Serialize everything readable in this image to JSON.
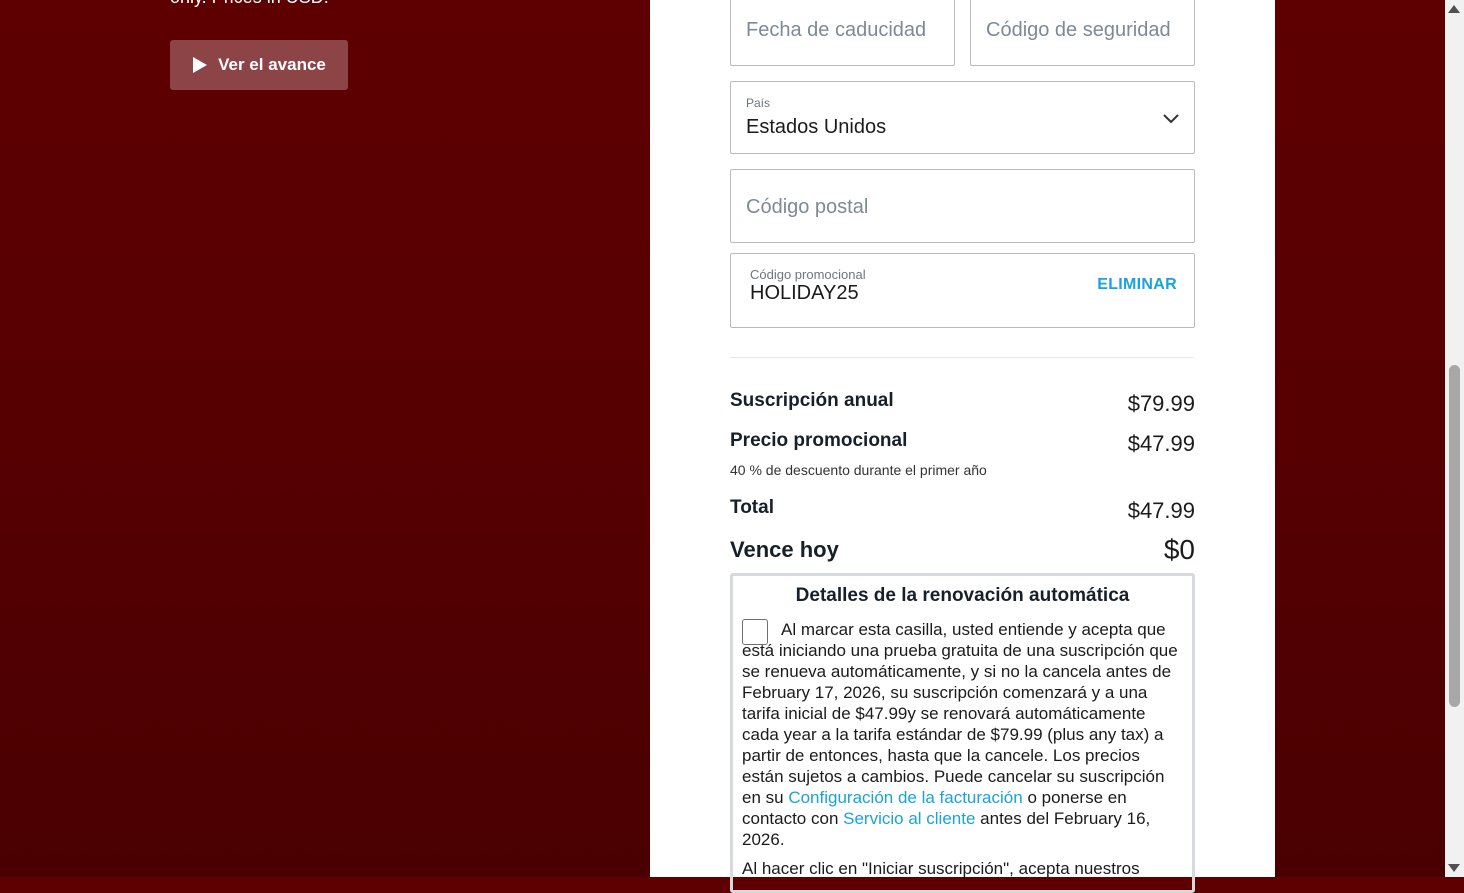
{
  "left": {
    "cut_text": "only. Prices in USD.",
    "preview_button": "Ver el avance"
  },
  "form": {
    "expiry_placeholder": "Fecha de caducidad",
    "cvv_placeholder": "Código de seguridad",
    "country_label": "País",
    "country_value": "Estados Unidos",
    "postal_placeholder": "Código postal",
    "promo_label": "Código promocional",
    "promo_value": "HOLIDAY25",
    "promo_remove": "ELIMINAR"
  },
  "summary": {
    "annual_label": "Suscripción anual",
    "annual_amount": "$79.99",
    "promo_label": "Precio promocional",
    "promo_amount": "$47.99",
    "promo_note": "40 % de descuento durante el primer año",
    "total_label": "Total",
    "total_amount": "$47.99",
    "due_label": "Vence hoy",
    "due_amount": "$0"
  },
  "renewal": {
    "title": "Detalles de la renovación automática",
    "text_part1": "Al marcar esta casilla, usted entiende y acepta que está iniciando una prueba gratuita de una suscripción que se renueva automáticamente, y si no la cancela antes de February 17, 2026, su suscripción comenzará y a una tarifa inicial de $47.99y se renovará automáticamente cada year a la tarifa estándar de $79.99 (plus any tax) a partir de entonces, hasta que la cancele. Los precios están sujetos a cambios. Puede cancelar su suscripción en su",
    "billing_link": "Configuración de la facturación",
    "text_part2": "o ponerse en contacto con",
    "support_link": "Servicio al cliente",
    "text_part3": "antes del February 16, 2026.",
    "terms_text": "Al hacer clic en \"Iniciar suscripción\", acepta nuestros"
  },
  "colors": {
    "background": "#560002",
    "accent_link": "#1aa3d8",
    "preview_button_bg": "#8d4446"
  }
}
